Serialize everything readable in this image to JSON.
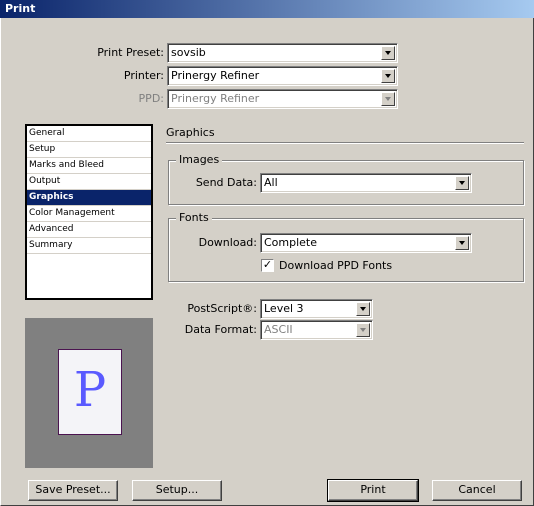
{
  "window": {
    "title": "Print"
  },
  "header": {
    "preset_label": "Print Preset:",
    "preset_value": "sovsib",
    "printer_label": "Printer:",
    "printer_value": "Prinergy Refiner",
    "ppd_label": "PPD:",
    "ppd_value": "Prinergy Refiner"
  },
  "sidebar": {
    "items": [
      {
        "label": "General"
      },
      {
        "label": "Setup"
      },
      {
        "label": "Marks and Bleed"
      },
      {
        "label": "Output"
      },
      {
        "label": "Graphics"
      },
      {
        "label": "Color Management"
      },
      {
        "label": "Advanced"
      },
      {
        "label": "Summary"
      }
    ],
    "active_index": 4
  },
  "preview": {
    "letter": "P"
  },
  "panel": {
    "title": "Graphics",
    "images": {
      "legend": "Images",
      "send_data_label": "Send Data:",
      "send_data_value": "All"
    },
    "fonts": {
      "legend": "Fonts",
      "download_label": "Download:",
      "download_value": "Complete",
      "download_ppd_label": "Download PPD Fonts",
      "download_ppd_checked": true
    },
    "postscript_label": "PostScript®:",
    "postscript_value": "Level 3",
    "data_format_label": "Data Format:",
    "data_format_value": "ASCII"
  },
  "buttons": {
    "save_preset": "Save Preset...",
    "setup": "Setup...",
    "print": "Print",
    "cancel": "Cancel"
  }
}
